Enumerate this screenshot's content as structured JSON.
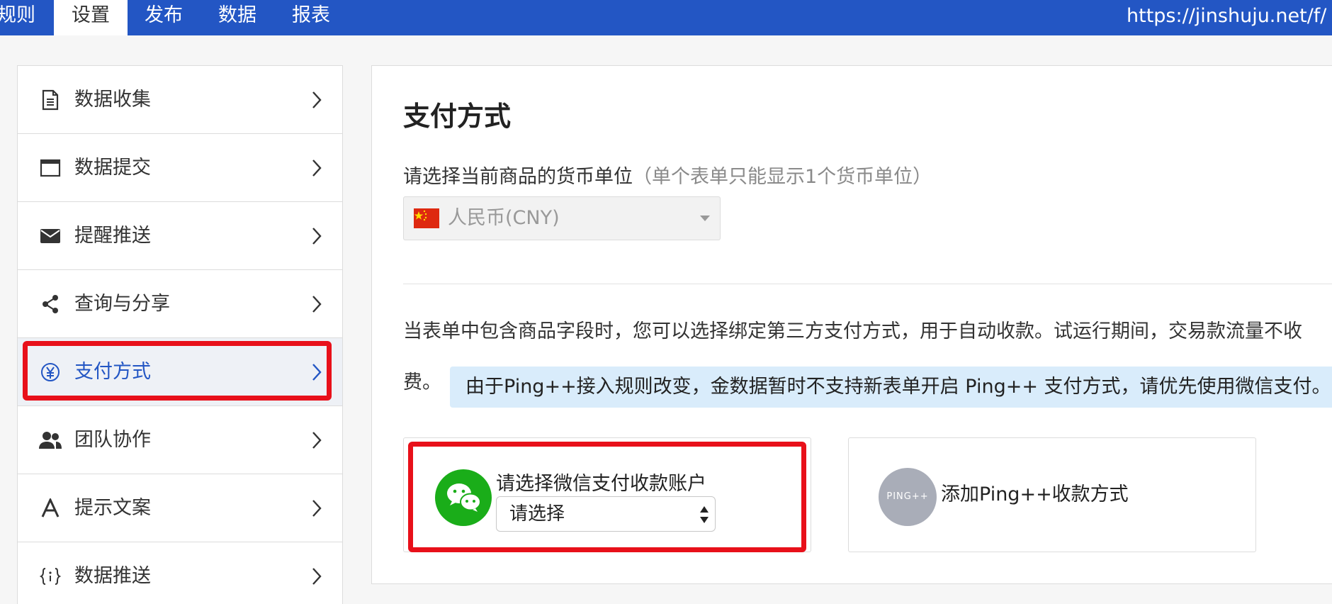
{
  "topbar": {
    "tabs": [
      {
        "label": "规则"
      },
      {
        "label": "设置"
      },
      {
        "label": "发布"
      },
      {
        "label": "数据"
      },
      {
        "label": "报表"
      }
    ],
    "active_tab": "设置",
    "url": "https://jinshuju.net/f/"
  },
  "sidebar": {
    "items": [
      {
        "label": "数据收集",
        "icon": "document-icon"
      },
      {
        "label": "数据提交",
        "icon": "window-icon"
      },
      {
        "label": "提醒推送",
        "icon": "envelope-icon"
      },
      {
        "label": "查询与分享",
        "icon": "share-icon"
      },
      {
        "label": "支付方式",
        "icon": "yen-icon"
      },
      {
        "label": "团队协作",
        "icon": "users-icon"
      },
      {
        "label": "提示文案",
        "icon": "font-icon"
      },
      {
        "label": "数据推送",
        "icon": "braces-icon"
      }
    ],
    "active_item": "支付方式"
  },
  "main": {
    "title": "支付方式",
    "currency_label": "请选择当前商品的货币单位",
    "currency_hint": "（单个表单只能显示1个货币单位）",
    "currency_value": "人民币(CNY)",
    "description_line1": "当表单中包含商品字段时，您可以选择绑定第三方支付方式，用于自动收款。试运行期间，交易款流量不收",
    "description_line2": "费。",
    "notice": "由于Ping++接入规则改变，金数据暂时不支持新表单开启 Ping++ 支付方式，请优先使用微信支付。",
    "wechat": {
      "label": "请选择微信支付收款账户",
      "select_value": "请选择"
    },
    "ping": {
      "logo_text": "PING++",
      "label": "添加Ping++收款方式"
    }
  },
  "colors": {
    "topbar": "#2356c4",
    "highlight": "#e8101a",
    "wechat_green": "#1aad19",
    "notice_bg": "#d9ecfb"
  }
}
